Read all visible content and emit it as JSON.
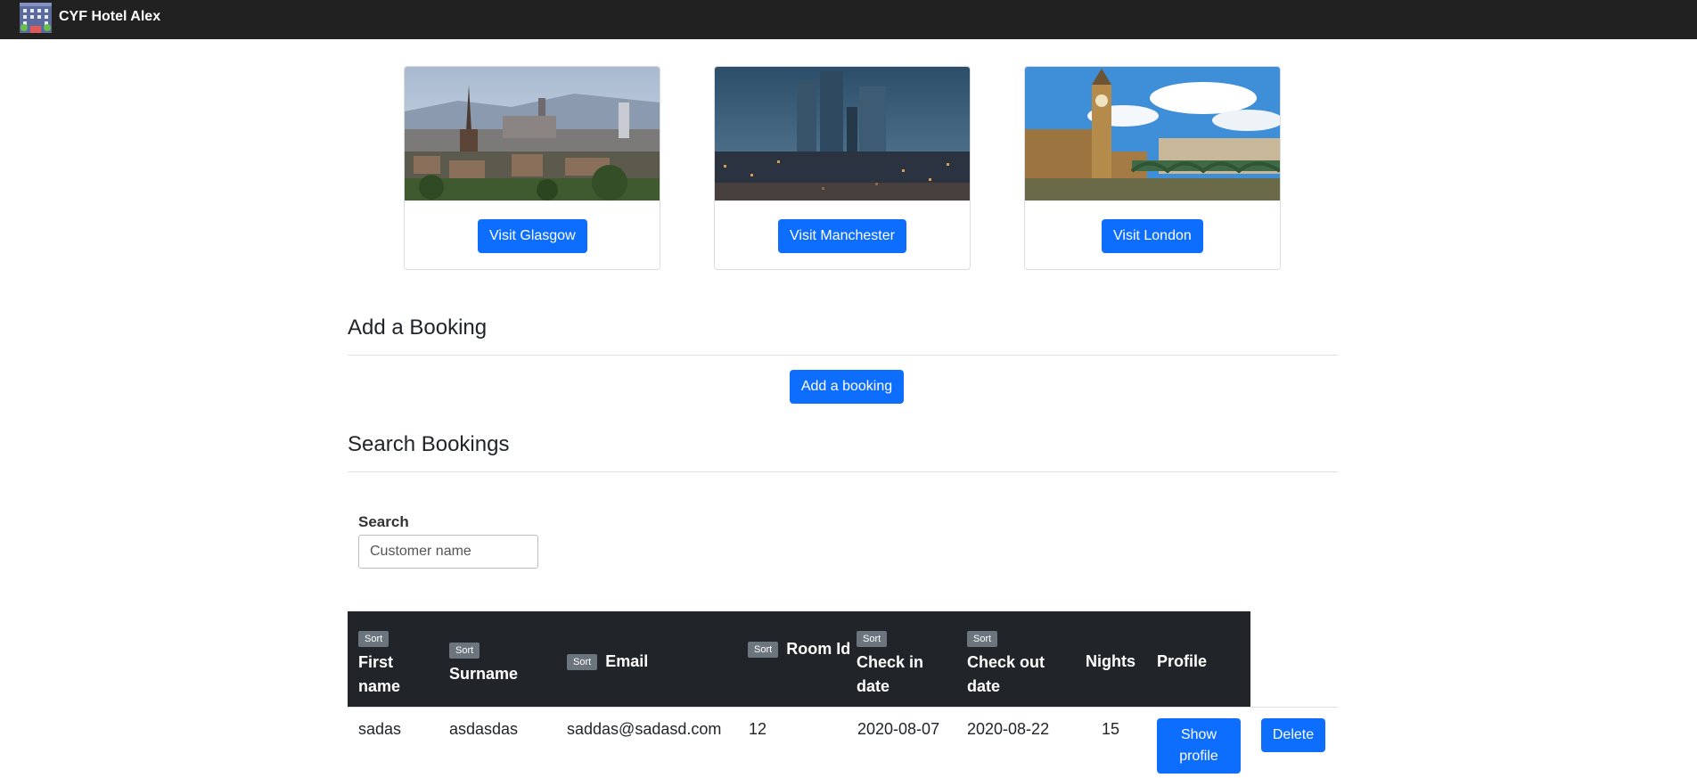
{
  "navbar": {
    "brand": "CYF Hotel Alex",
    "logo_icon": "hotel-building-icon",
    "background": "#212121"
  },
  "cities": [
    {
      "name": "Glasgow",
      "button_label": "Visit Glasgow",
      "image": "glasgow-skyline-photo"
    },
    {
      "name": "Manchester",
      "button_label": "Visit Manchester",
      "image": "manchester-towers-photo"
    },
    {
      "name": "London",
      "button_label": "Visit London",
      "image": "london-big-ben-photo"
    }
  ],
  "add_booking": {
    "heading": "Add a Booking",
    "button_label": "Add a booking"
  },
  "search": {
    "heading": "Search Bookings",
    "label": "Search",
    "placeholder": "Customer name",
    "value": ""
  },
  "table": {
    "sort_label": "Sort",
    "headers": {
      "first_name": "First name",
      "surname": "Surname",
      "email": "Email",
      "room_id": "Room Id",
      "check_in": "Check in date",
      "check_out": "Check out date",
      "nights": "Nights",
      "profile": "Profile"
    },
    "rows": [
      {
        "first_name": "sadas",
        "surname": "asdasdas",
        "email": "saddas@sadasd.com",
        "room_id": "12",
        "check_in": "2020-08-07",
        "check_out": "2020-08-22",
        "nights": "15",
        "profile_button": "Show profile",
        "delete_button": "Delete"
      }
    ]
  },
  "colors": {
    "primary_button": "#0d6efd",
    "table_header": "#212529",
    "sort_badge": "#6c757d"
  }
}
